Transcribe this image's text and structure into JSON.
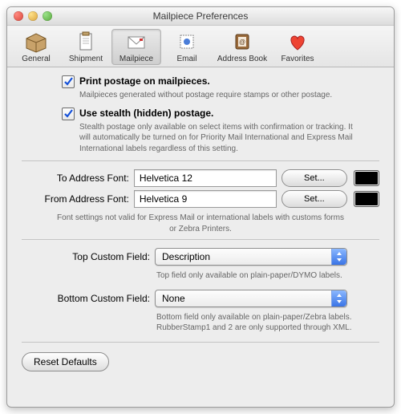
{
  "window": {
    "title": "Mailpiece Preferences"
  },
  "toolbar": {
    "items": [
      {
        "label": "General"
      },
      {
        "label": "Shipment"
      },
      {
        "label": "Mailpiece"
      },
      {
        "label": "Email"
      },
      {
        "label": "Address Book"
      },
      {
        "label": "Favorites"
      }
    ],
    "selected_index": 2
  },
  "options": {
    "print_postage": {
      "checked": true,
      "label": "Print postage on mailpieces.",
      "desc": "Mailpieces generated without postage require stamps or other postage."
    },
    "stealth_postage": {
      "checked": true,
      "label": "Use stealth (hidden) postage.",
      "desc": "Stealth postage only available on select items with confirmation or tracking. It will automatically be turned on for Priority Mail International and Express Mail International labels regardless of this setting."
    }
  },
  "fonts": {
    "to": {
      "label": "To Address Font:",
      "value": "Helvetica 12",
      "set_label": "Set...",
      "swatch": "#000000"
    },
    "from": {
      "label": "From Address Font:",
      "value": "Helvetica 9",
      "set_label": "Set...",
      "swatch": "#000000"
    },
    "note": "Font settings not valid for Express Mail or international labels with customs forms or Zebra Printers."
  },
  "custom_fields": {
    "top": {
      "label": "Top Custom Field:",
      "value": "Description",
      "note": "Top field only available on plain-paper/DYMO labels."
    },
    "bottom": {
      "label": "Bottom Custom Field:",
      "value": "None",
      "note": "Bottom field only available on plain-paper/Zebra labels. RubberStamp1 and 2 are only supported through XML."
    }
  },
  "buttons": {
    "reset_defaults": "Reset Defaults"
  }
}
